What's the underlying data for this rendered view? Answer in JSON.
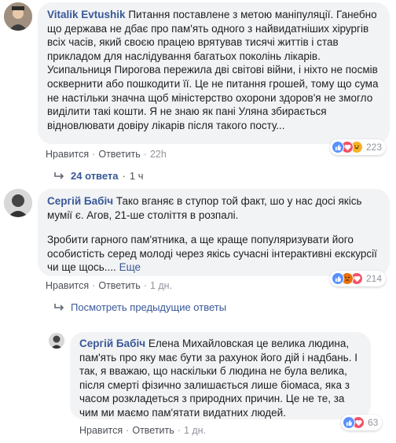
{
  "comments": [
    {
      "author": "Vitalik Evtushik",
      "text": "Питання поставлене з метою маніпуляції. Ганебно що держава не дбає про пам'ять одного з найвидатніших хірургів всіх часів, який своєю працею врятував тисячі життів і став прикладом для наслідування багатьох поколінь лікарів. Усипальниця Пирогова пережила дві світові війни, і ніхто не посмів осквернити або пошкодити її. Це не питання грошей, тому що сума не настільки значна щоб міністерство охорони здоров'я не змогло виділити такі кошти. Я не знаю як пані Уляна збирається відновлювати довіру лікарів після такого посту...",
      "like": "Нравится",
      "reply": "Ответить",
      "time": "22h",
      "reaction_count": "223",
      "reactions": [
        "like",
        "love",
        "haha"
      ]
    },
    {
      "author": "Сергій Бабіч",
      "text": "Тако вганяє в ступор той факт, шо у нас досі якісь мумії є. Агов, 21-ше століття в розпалі.",
      "text2": "Зробити гарного пам'ятника, а ще краще популяризувати його особистість серед молоді через якісь сучасні інтерактивні екскурсії чи ще щось....",
      "see_more": "Еще",
      "like": "Нравится",
      "reply": "Ответить",
      "time": "1 дн.",
      "reaction_count": "214",
      "reactions": [
        "like",
        "angry",
        "love"
      ]
    },
    {
      "author": "Сергій Бабіч",
      "text": "Елена Михайловская це велика людина, пам'ять про яку має бути за рахунок його дій і надбань. І так, я вважаю, що наскільки б людина не була велика, після смерті фізично залишається лише біомаса, яка з часом розкладеться з природних причин. Це не те, за чим ми маємо пам'ятати видатних людей.",
      "like": "Нравится",
      "reply": "Ответить",
      "time": "1 дн.",
      "reaction_count": "63",
      "reactions": [
        "like",
        "love"
      ]
    }
  ],
  "replies_link": {
    "count": "24 ответа",
    "time": "1 ч"
  },
  "previous_replies": "Посмотреть предыдущие ответы",
  "colors": {
    "like": "#5890ff",
    "love": "#f25268",
    "haha": "#f7b125",
    "angry": "#e9710f",
    "link": "#385898"
  }
}
